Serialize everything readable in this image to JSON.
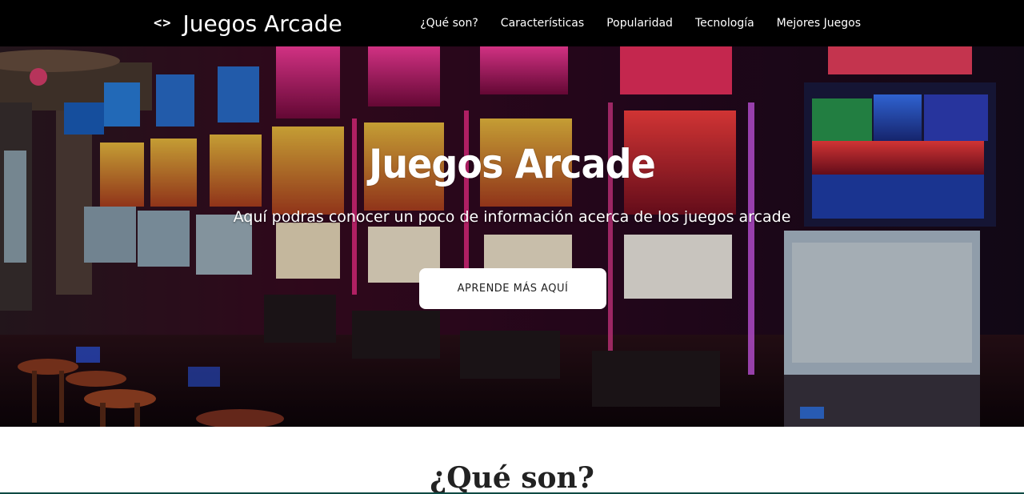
{
  "navbar": {
    "brand_icon": "<>",
    "brand_text": "Juegos Arcade",
    "links": [
      "¿Qué son?",
      "Características",
      "Popularidad",
      "Tecnología",
      "Mejores Juegos"
    ]
  },
  "hero": {
    "background_image": "casino slot machines photo",
    "title": "Juegos Arcade",
    "subtitle": "Aquí podras conocer un poco de información acerca de los juegos arcade",
    "button_label": "APRENDE MÁS AQUÍ"
  },
  "section": {
    "title": "¿Qué son?"
  },
  "colors": {
    "navbar_bg": "#000000",
    "text_light": "#ffffff",
    "button_bg": "#ffffff"
  }
}
